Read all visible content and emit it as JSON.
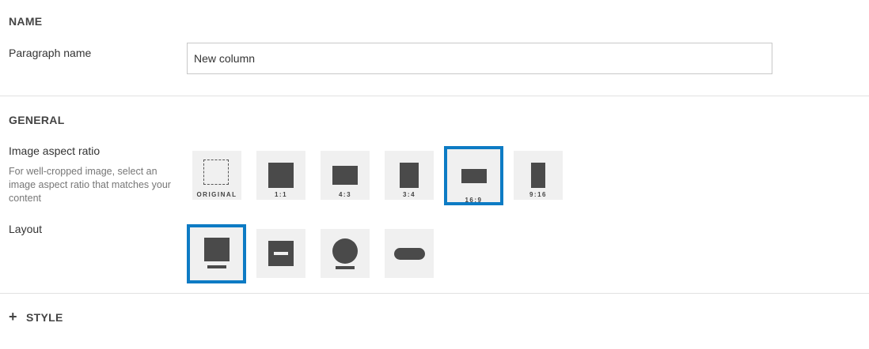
{
  "name_section": {
    "title": "NAME",
    "paragraph_label": "Paragraph name",
    "paragraph_value": "New column"
  },
  "general_section": {
    "title": "GENERAL",
    "aspect_label": "Image aspect ratio",
    "aspect_help": "For well-cropped image, select an image aspect ratio that matches your content",
    "aspect_options": [
      {
        "label": "ORIGINAL",
        "selected": false
      },
      {
        "label": "1:1",
        "selected": false
      },
      {
        "label": "4:3",
        "selected": false
      },
      {
        "label": "3:4",
        "selected": false
      },
      {
        "label": "16:9",
        "selected": true
      },
      {
        "label": "9:16",
        "selected": false
      }
    ],
    "layout_label": "Layout",
    "layout_options": [
      {
        "name": "image-top",
        "selected": true
      },
      {
        "name": "image-with-text-overlay",
        "selected": false
      },
      {
        "name": "circle-image",
        "selected": false
      },
      {
        "name": "pill",
        "selected": false
      }
    ]
  },
  "style_section": {
    "expand_icon": "+",
    "title": "STYLE"
  },
  "colors": {
    "selected_border": "#0d7bc4",
    "tile_bg": "#f0f0f0",
    "shape": "#4a4a4a"
  }
}
